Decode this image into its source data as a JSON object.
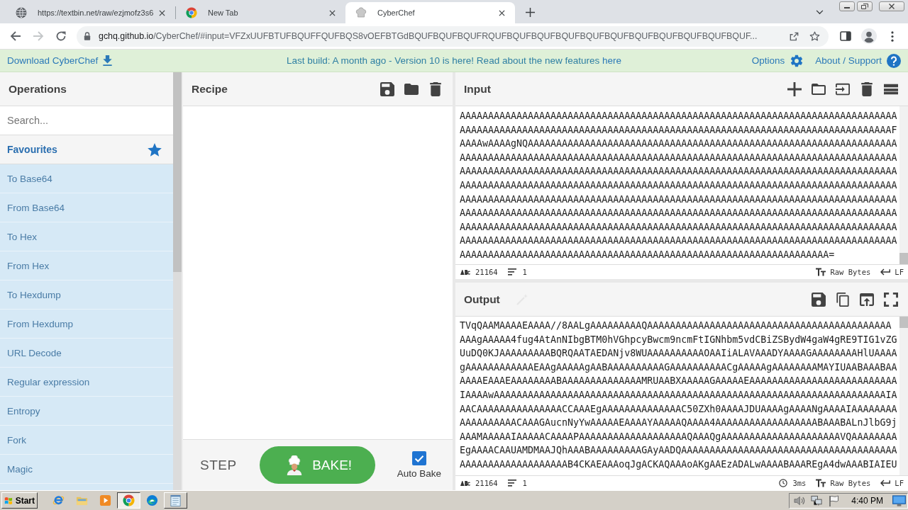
{
  "browser": {
    "tabs": [
      {
        "kind": "page",
        "title": "https://textbin.net/raw/ezjmofz3s6",
        "selected": false
      },
      {
        "kind": "newtab",
        "title": "New Tab",
        "selected": false
      },
      {
        "kind": "webapp",
        "title": "CyberChef",
        "selected": true
      }
    ],
    "forward": {
      "disabled": true
    },
    "address": {
      "host": "gchq.github.io",
      "path": "/CyberChef/#input=VFZxUUFBTUFBQUFFQUFBQS8vOEFBTGdBQUFBQUFBQUFRQUFBQUFBQUFBQUFBQUFBQUFBQUFBQUFBQUFBQUFBQUF..."
    }
  },
  "banner": {
    "download": "Download CyberChef",
    "notice": "Last build: A month ago - Version 10 is here! Read about the new features",
    "notice_link": "here",
    "options": "Options",
    "about": "About / Support"
  },
  "operations": {
    "title": "Operations",
    "search": {
      "placeholder": "Search..."
    },
    "favourites": "Favourites",
    "items": [
      "To Base64",
      "From Base64",
      "To Hex",
      "From Hex",
      "To Hexdump",
      "From Hexdump",
      "URL Decode",
      "Regular expression",
      "Entropy",
      "Fork",
      "Magic"
    ]
  },
  "recipe": {
    "title": "Recipe",
    "step": "STEP",
    "bake": "BAKE!",
    "auto_bake": {
      "label": "Auto Bake",
      "checked": true
    }
  },
  "input": {
    "title": "Input",
    "lines": [
      "AAAAAAAAAAAAAAAAAAAAAAAAAAAAAAAAAAAAAAAAAAAAAAAAAAAAAAAAAAAAAAAAAAAAAAAAAAAAA",
      "AAAAAAAAAAAAAAAAAAAAAAAAAAAAAAAAAAAAAAAAAAAAAAAAAAAAAAAAAAAAAAAAAAAAAAAAAAAAF",
      "AAAAwAAAAgNQAAAAAAAAAAAAAAAAAAAAAAAAAAAAAAAAAAAAAAAAAAAAAAAAAAAAAAAAAAAAAAAAA",
      "AAAAAAAAAAAAAAAAAAAAAAAAAAAAAAAAAAAAAAAAAAAAAAAAAAAAAAAAAAAAAAAAAAAAAAAAAAAAA",
      "AAAAAAAAAAAAAAAAAAAAAAAAAAAAAAAAAAAAAAAAAAAAAAAAAAAAAAAAAAAAAAAAAAAAAAAAAAAAA",
      "AAAAAAAAAAAAAAAAAAAAAAAAAAAAAAAAAAAAAAAAAAAAAAAAAAAAAAAAAAAAAAAAAAAAAAAAAAAAA",
      "AAAAAAAAAAAAAAAAAAAAAAAAAAAAAAAAAAAAAAAAAAAAAAAAAAAAAAAAAAAAAAAAAAAAAAAAAAAAA",
      "AAAAAAAAAAAAAAAAAAAAAAAAAAAAAAAAAAAAAAAAAAAAAAAAAAAAAAAAAAAAAAAAAAAAAAAAAAAAA",
      "AAAAAAAAAAAAAAAAAAAAAAAAAAAAAAAAAAAAAAAAAAAAAAAAAAAAAAAAAAAAAAAAAAAAAAAAAAAAA",
      "AAAAAAAAAAAAAAAAAAAAAAAAAAAAAAAAAAAAAAAAAAAAAAAAAAAAAAAAAAAAAAAAAAAAAAAAAAAAA",
      "AAAAAAAAAAAAAAAAAAAAAAAAAAAAAAAAAAAAAAAAAAAAAAAAAAAAAAAAAAAAAAAAA="
    ],
    "status": {
      "length": "21164",
      "lines": "1",
      "format": "Raw Bytes",
      "eol": "LF"
    }
  },
  "output": {
    "title": "Output",
    "magic": {
      "disabled": true
    },
    "lines": [
      "TVqQAAMAAAAEAAAA//8AALgAAAAAAAAAQAAAAAAAAAAAAAAAAAAAAAAAAAAAAAAAAAAAAAAAAAAA",
      "AAAgAAAAA4fug4AtAnNIbgBTM0hVGhpcyBwcm9ncmFtIGNhbm5vdCBiZSBydW4gaW4gRE9TIG1vZG",
      "UuDQ0KJAAAAAAAAABQRQAATAEDANjv8WUAAAAAAAAAAOAAIiALAVAAADYAAAAGAAAAAAAAHlUAAAA",
      "gAAAAAAAAAAAAEAAgAAAAAgAABAAAAAAAAAAGAAAAAAAAAACgAAAAAgAAAAAAAAMAYIUAABAAABAA",
      "AAAAEAAAEAAAAAAAABAAAAAAAAAAAAAAMRUAABXAAAAAGAAAAAEAAAAAAAAAAAAAAAAAAAAAAAAAA",
      "IAAAAwAAAAAAAAAAAAAAAAAAAAAAAAAAAAAAAAAAAAAAAAAAAAAAAAAAAAAAAAAAAAAAAAAAAAAIA",
      "AACAAAAAAAAAAAAAAACCAAAEgAAAAAAAAAAAAAAC50ZXh0AAAAJDUAAAAgAAAANgAAAAIAAAAAAAA",
      "AAAAAAAAAACAAAGAucnNyYwAAAAAEAAAAYAAAAAQAAAA4AAAAAAAAAAAAAAAAAABAAABALnJlbG9j",
      "AAAMAAAAAIAAAAACAAAAPAAAAAAAAAAAAAAAAAAAQAAAQgAAAAAAAAAAAAAAAAAAAAAVQAAAAAAAA",
      "EgAAAACAAUAMDMAAJQhAAABAAAAAAAAAGAyAADQAAAAAAAAAAAAAAAAAAAAAAAAAAAAAAAAAAAAAA",
      "AAAAAAAAAAAAAAAAAAAB4CKAEAAAoqJgACKAQAAAoAKgAAEzADALwAAAABAAAREgA4dwAAABIAIEU"
    ],
    "status": {
      "length": "21164",
      "lines": "1",
      "time": "3ms",
      "format": "Raw Bytes",
      "eol": "LF"
    }
  },
  "taskbar": {
    "start": "Start",
    "apps": [
      {
        "kind": "ie",
        "open": false,
        "selected": false
      },
      {
        "kind": "explorer",
        "open": false,
        "selected": false
      },
      {
        "kind": "media",
        "open": false,
        "selected": false
      },
      {
        "kind": "chrome",
        "open": true,
        "selected": true
      },
      {
        "kind": "edge",
        "open": false,
        "selected": false
      },
      {
        "kind": "notepad",
        "open": true,
        "selected": false
      }
    ],
    "clock": "4:40 PM"
  }
}
